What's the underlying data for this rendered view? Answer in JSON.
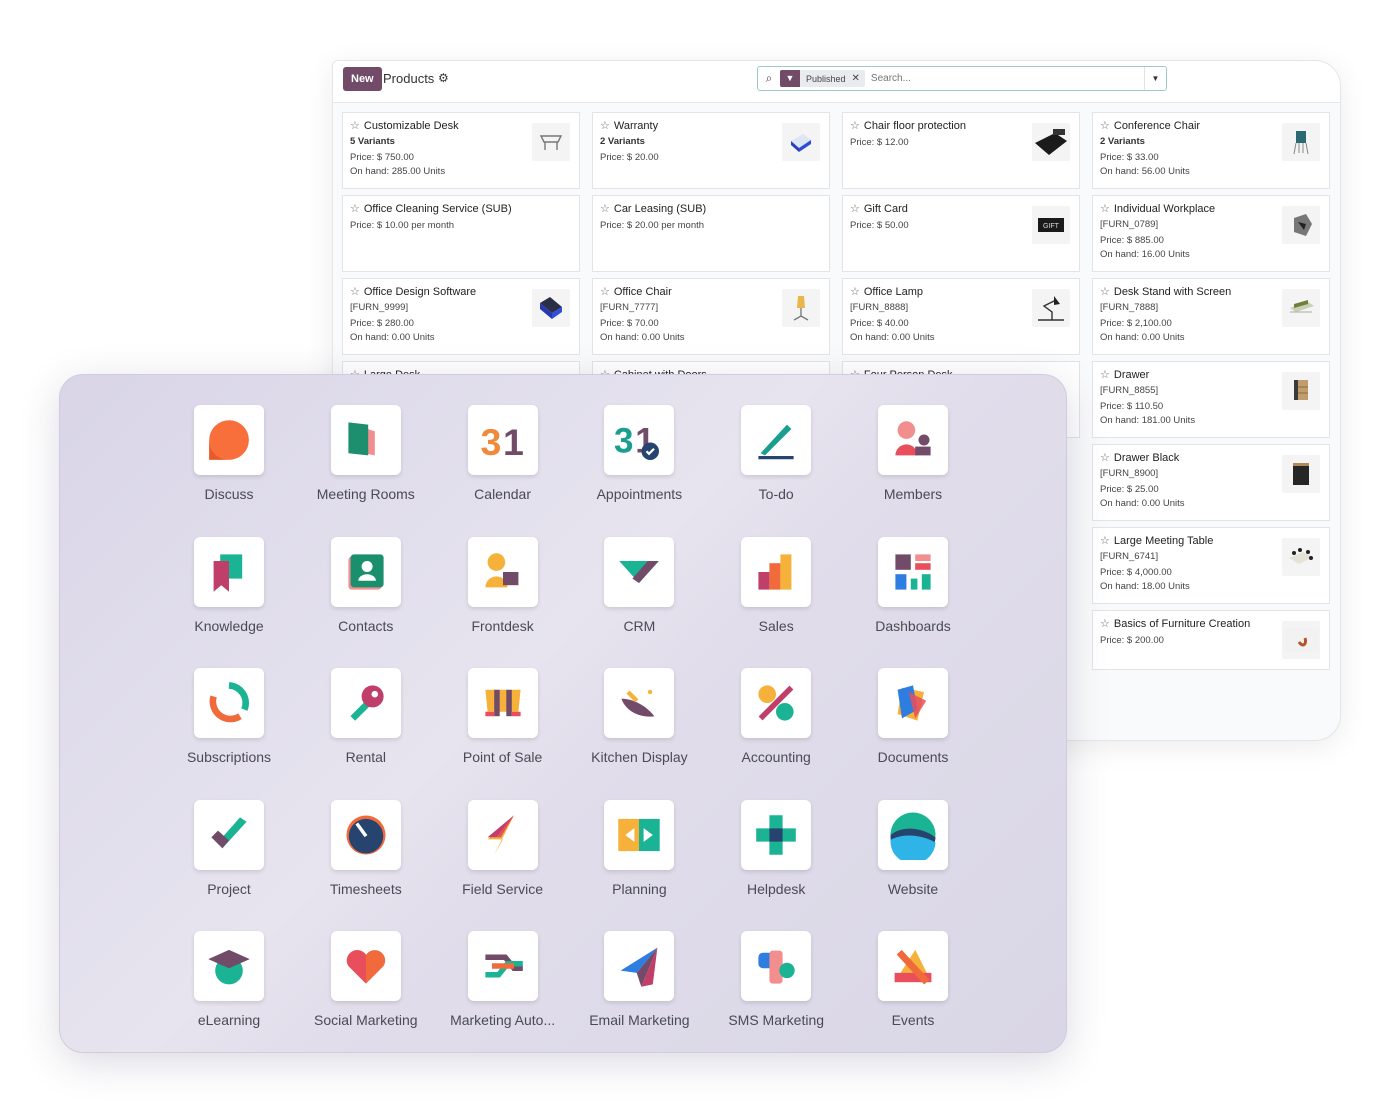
{
  "products_view": {
    "new_label": "New",
    "title": "Products",
    "gear_icon": "gear-icon",
    "search": {
      "facet_icon": "filter-icon",
      "facet_label": "Published",
      "placeholder": "Search..."
    },
    "accent": "#714b67",
    "cards": [
      {
        "name": "Customizable Desk",
        "lines": [
          "5 Variants",
          "Price: $ 750.00",
          "On hand: 285.00 Units"
        ],
        "bold_first": true,
        "thumb": "desk"
      },
      {
        "name": "Warranty",
        "lines": [
          "2 Variants",
          "Price: $ 20.00"
        ],
        "bold_first": true,
        "thumb": "box-blue"
      },
      {
        "name": "Chair floor protection",
        "lines": [
          "Price: $ 12.00"
        ],
        "thumb": "mat-black"
      },
      {
        "name": "Conference Chair",
        "lines": [
          "2 Variants",
          "Price: $ 33.00",
          "On hand: 56.00 Units"
        ],
        "bold_first": true,
        "thumb": "chair-teal"
      },
      {
        "name": "Office Cleaning Service (SUB)",
        "lines": [
          "Price: $ 10.00 per month"
        ]
      },
      {
        "name": "Car Leasing (SUB)",
        "lines": [
          "Price: $ 20.00 per month"
        ]
      },
      {
        "name": "Gift Card",
        "lines": [
          "Price: $ 50.00"
        ],
        "thumb": "gift"
      },
      {
        "name": "Individual Workplace",
        "lines": [
          "[FURN_0789]",
          "Price: $ 885.00",
          "On hand: 16.00 Units"
        ],
        "thumb": "workplace"
      },
      {
        "name": "Office Design Software",
        "lines": [
          "[FURN_9999]",
          "Price: $ 280.00",
          "On hand: 0.00 Units"
        ],
        "thumb": "box-dark"
      },
      {
        "name": "Office Chair",
        "lines": [
          "[FURN_7777]",
          "Price: $ 70.00",
          "On hand: 0.00 Units"
        ],
        "thumb": "chair-yellow"
      },
      {
        "name": "Office Lamp",
        "lines": [
          "[FURN_8888]",
          "Price: $ 40.00",
          "On hand: 0.00 Units"
        ],
        "thumb": "lamp"
      },
      {
        "name": "Desk Stand with Screen",
        "lines": [
          "[FURN_7888]",
          "Price: $ 2,100.00",
          "On hand: 0.00 Units"
        ],
        "thumb": "stand"
      },
      {
        "name": "Large Desk",
        "lines": []
      },
      {
        "name": "Cabinet with Doors",
        "lines": []
      },
      {
        "name": "Four Person Desk",
        "lines": []
      },
      {
        "name": "Drawer",
        "lines": [
          "[FURN_8855]",
          "Price: $ 110.50",
          "On hand: 181.00 Units"
        ],
        "thumb": "drawer-wood"
      },
      {
        "name": "Drawer Black",
        "lines": [
          "[FURN_8900]",
          "Price: $ 25.00",
          "On hand: 0.00 Units"
        ],
        "thumb": "drawer-black"
      },
      {
        "name": "Large Meeting Table",
        "lines": [
          "[FURN_6741]",
          "Price: $ 4,000.00",
          "On hand: 18.00 Units"
        ],
        "thumb": "table"
      },
      {
        "name": "Basics of Furniture Creation",
        "lines": [
          "Price: $ 200.00"
        ],
        "thumb": "course"
      }
    ]
  },
  "apps": [
    {
      "label": "Discuss",
      "icon": "discuss"
    },
    {
      "label": "Meeting Rooms",
      "icon": "meeting-rooms"
    },
    {
      "label": "Calendar",
      "icon": "calendar"
    },
    {
      "label": "Appointments",
      "icon": "appointments"
    },
    {
      "label": "To-do",
      "icon": "todo"
    },
    {
      "label": "Members",
      "icon": "members"
    },
    {
      "label": "Knowledge",
      "icon": "knowledge"
    },
    {
      "label": "Contacts",
      "icon": "contacts"
    },
    {
      "label": "Frontdesk",
      "icon": "frontdesk"
    },
    {
      "label": "CRM",
      "icon": "crm"
    },
    {
      "label": "Sales",
      "icon": "sales"
    },
    {
      "label": "Dashboards",
      "icon": "dashboards"
    },
    {
      "label": "Subscriptions",
      "icon": "subscriptions"
    },
    {
      "label": "Rental",
      "icon": "rental"
    },
    {
      "label": "Point of Sale",
      "icon": "point-of-sale"
    },
    {
      "label": "Kitchen Display",
      "icon": "kitchen-display"
    },
    {
      "label": "Accounting",
      "icon": "accounting"
    },
    {
      "label": "Documents",
      "icon": "documents"
    },
    {
      "label": "Project",
      "icon": "project"
    },
    {
      "label": "Timesheets",
      "icon": "timesheets"
    },
    {
      "label": "Field Service",
      "icon": "field-service"
    },
    {
      "label": "Planning",
      "icon": "planning"
    },
    {
      "label": "Helpdesk",
      "icon": "helpdesk"
    },
    {
      "label": "Website",
      "icon": "website"
    },
    {
      "label": "eLearning",
      "icon": "elearning"
    },
    {
      "label": "Social Marketing",
      "icon": "social-marketing"
    },
    {
      "label": "Marketing Auto...",
      "icon": "marketing-automation"
    },
    {
      "label": "Email Marketing",
      "icon": "email-marketing"
    },
    {
      "label": "SMS Marketing",
      "icon": "sms-marketing"
    },
    {
      "label": "Events",
      "icon": "events"
    }
  ]
}
